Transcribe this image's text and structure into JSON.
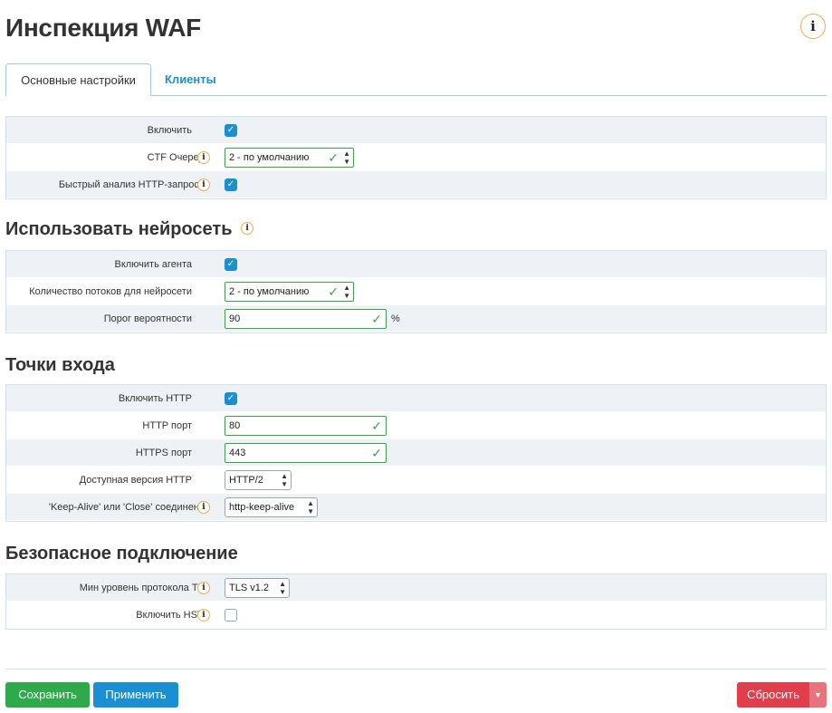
{
  "page": {
    "title": "Инспекция WAF",
    "help": "i"
  },
  "tabs": {
    "main": "Основные настройки",
    "clients": "Клиенты"
  },
  "general": {
    "enable_label": "Включить",
    "enable_checked": true,
    "ctf_queues_label": "CTF Очереди",
    "ctf_queues_value": "2 - по умолчанию",
    "fast_http_label": "Быстрый анализ HTTP-запросов",
    "fast_http_checked": true
  },
  "neural": {
    "title": "Использовать нейросеть",
    "enable_agent_label": "Включить агента",
    "enable_agent_checked": true,
    "threads_label": "Количество потоков для нейросети",
    "threads_value": "2 - по умолчанию",
    "threshold_label": "Порог вероятности",
    "threshold_value": "90",
    "threshold_unit": "%"
  },
  "entry": {
    "title": "Точки входа",
    "enable_http_label": "Включить HTTP",
    "enable_http_checked": true,
    "http_port_label": "HTTP порт",
    "http_port_value": "80",
    "https_port_label": "HTTPS порт",
    "https_port_value": "443",
    "http_version_label": "Доступная версия HTTP",
    "http_version_value": "HTTP/2",
    "keepalive_label": "'Keep-Alive' или 'Close' соединения",
    "keepalive_value": "http-keep-alive"
  },
  "secure": {
    "title": "Безопасное подключение",
    "tls_label": "Мин уровень протокола TLS",
    "tls_value": "TLS v1.2",
    "hsts_label": "Включить HSTS",
    "hsts_checked": false
  },
  "buttons": {
    "save": "Сохранить",
    "apply": "Применить",
    "reset": "Сбросить"
  },
  "colors": {
    "accent": "#1a8fd1",
    "success": "#2eaa4a",
    "danger": "#e23d4b",
    "warning": "#f0ad4e"
  }
}
